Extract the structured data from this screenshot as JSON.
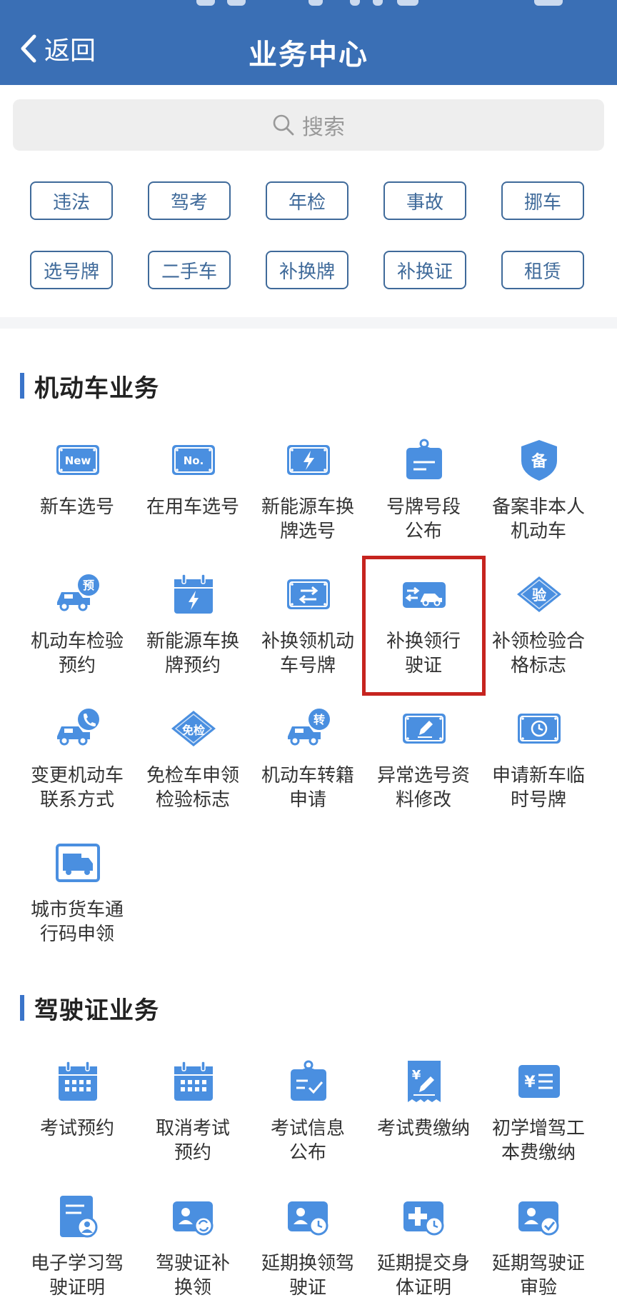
{
  "header": {
    "back_label": "返回",
    "title": "业务中心"
  },
  "search": {
    "placeholder": "搜索"
  },
  "quick_tags": [
    "违法",
    "驾考",
    "年检",
    "事故",
    "挪车",
    "选号牌",
    "二手车",
    "补换牌",
    "补换证",
    "租赁"
  ],
  "motor_section": {
    "title": "机动车业务",
    "items": [
      {
        "label": "新车选号",
        "icon": "new-plate-icon"
      },
      {
        "label": "在用车选号",
        "icon": "no-plate-icon"
      },
      {
        "label": "新能源车换牌选号",
        "icon": "ev-plate-icon"
      },
      {
        "label": "号牌号段公布",
        "icon": "plate-notice-icon"
      },
      {
        "label": "备案非本人机动车",
        "icon": "record-shield-icon"
      },
      {
        "label": "机动车检验预约",
        "icon": "inspection-booking-icon"
      },
      {
        "label": "新能源车换牌预约",
        "icon": "ev-calendar-icon"
      },
      {
        "label": "补换领机动车号牌",
        "icon": "plate-exchange-icon"
      },
      {
        "label": "补换领行驶证",
        "icon": "license-exchange-icon"
      },
      {
        "label": "补领检验合格标志",
        "icon": "inspection-mark-icon"
      },
      {
        "label": "变更机动车联系方式",
        "icon": "change-contact-icon"
      },
      {
        "label": "免检车申领检验标志",
        "icon": "exempt-badge-icon"
      },
      {
        "label": "机动车转籍申请",
        "icon": "transfer-icon"
      },
      {
        "label": "异常选号资料修改",
        "icon": "edit-plate-icon"
      },
      {
        "label": "申请新车临时号牌",
        "icon": "temp-plate-icon"
      },
      {
        "label": "城市货车通行码申领",
        "icon": "truck-pass-icon"
      }
    ]
  },
  "license_section": {
    "title": "驾驶证业务",
    "items": [
      {
        "label": "考试预约",
        "icon": "exam-calendar-icon"
      },
      {
        "label": "取消考试预约",
        "icon": "cancel-exam-icon"
      },
      {
        "label": "考试信息公布",
        "icon": "exam-notice-icon"
      },
      {
        "label": "考试费缴纳",
        "icon": "exam-fee-icon"
      },
      {
        "label": "初学增驾工本费缴纳",
        "icon": "cost-fee-icon"
      },
      {
        "label": "电子学习驾驶证明",
        "icon": "e-certificate-icon"
      },
      {
        "label": "驾驶证补换领",
        "icon": "license-renew-icon"
      },
      {
        "label": "延期换领驾驶证",
        "icon": "postpone-renew-icon"
      },
      {
        "label": "延期提交身体证明",
        "icon": "postpone-health-icon"
      },
      {
        "label": "延期驾驶证审验",
        "icon": "postpone-review-icon"
      }
    ]
  },
  "colors": {
    "header_bg": "#3a6fb5",
    "icon_blue": "#4a8fe0",
    "highlight_red": "#c6241f",
    "tag_border": "#3f6a9a"
  }
}
